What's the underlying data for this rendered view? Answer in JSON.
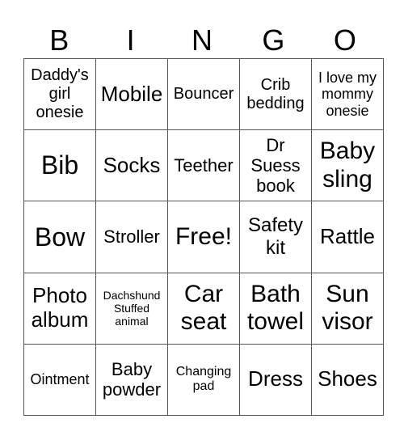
{
  "header": [
    "B",
    "I",
    "N",
    "G",
    "O"
  ],
  "rows": [
    [
      "Daddy's girl onesie",
      "Mobile",
      "Bouncer",
      "Crib bedding",
      "I love my mommy onesie"
    ],
    [
      "Bib",
      "Socks",
      "Teether",
      "Dr Suess book",
      "Baby sling"
    ],
    [
      "Bow",
      "Stroller",
      "Free!",
      "Safety kit",
      "Rattle"
    ],
    [
      "Photo album",
      "Dachshund Stuffed animal",
      "Car seat",
      "Bath towel",
      "Sun visor"
    ],
    [
      "Ointment",
      "Baby powder",
      "Changing pad",
      "Dress",
      "Shoes"
    ]
  ]
}
